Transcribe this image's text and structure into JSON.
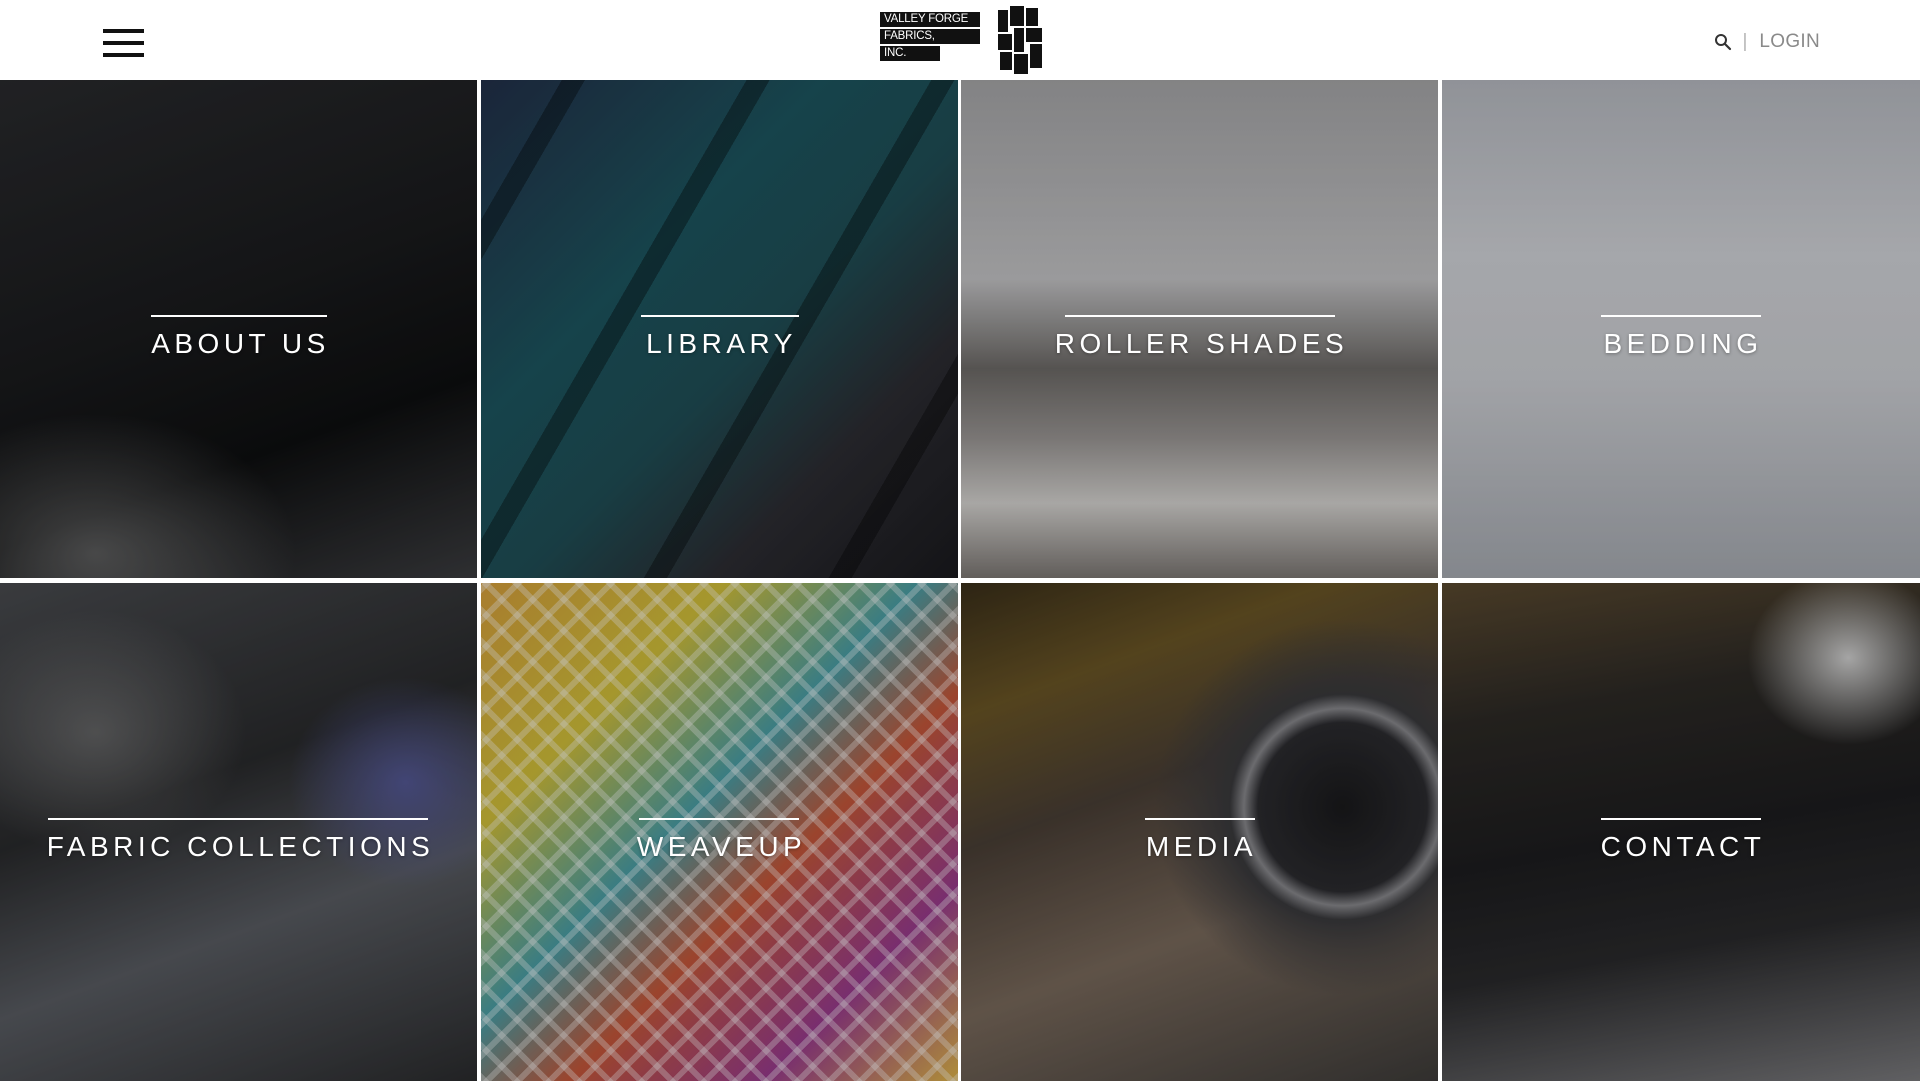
{
  "header": {
    "logo": {
      "line1": "VALLEY FORGE",
      "line2": "FABRICS,",
      "line3": "INC."
    },
    "search_icon": "search-icon",
    "separator": "|",
    "login_label": "LOGIN",
    "menu_icon": "hamburger-menu-icon"
  },
  "tiles": [
    {
      "label": "ABOUT US"
    },
    {
      "label": "LIBRARY"
    },
    {
      "label": "ROLLER SHADES"
    },
    {
      "label": "BEDDING"
    },
    {
      "label": "FABRIC COLLECTIONS"
    },
    {
      "label": "WEAVEUP"
    },
    {
      "label": "MEDIA"
    },
    {
      "label": "CONTACT"
    }
  ],
  "colors": {
    "caption_text": "#ffffff",
    "header_bg": "#ffffff",
    "login_text": "#8a8a8a"
  }
}
